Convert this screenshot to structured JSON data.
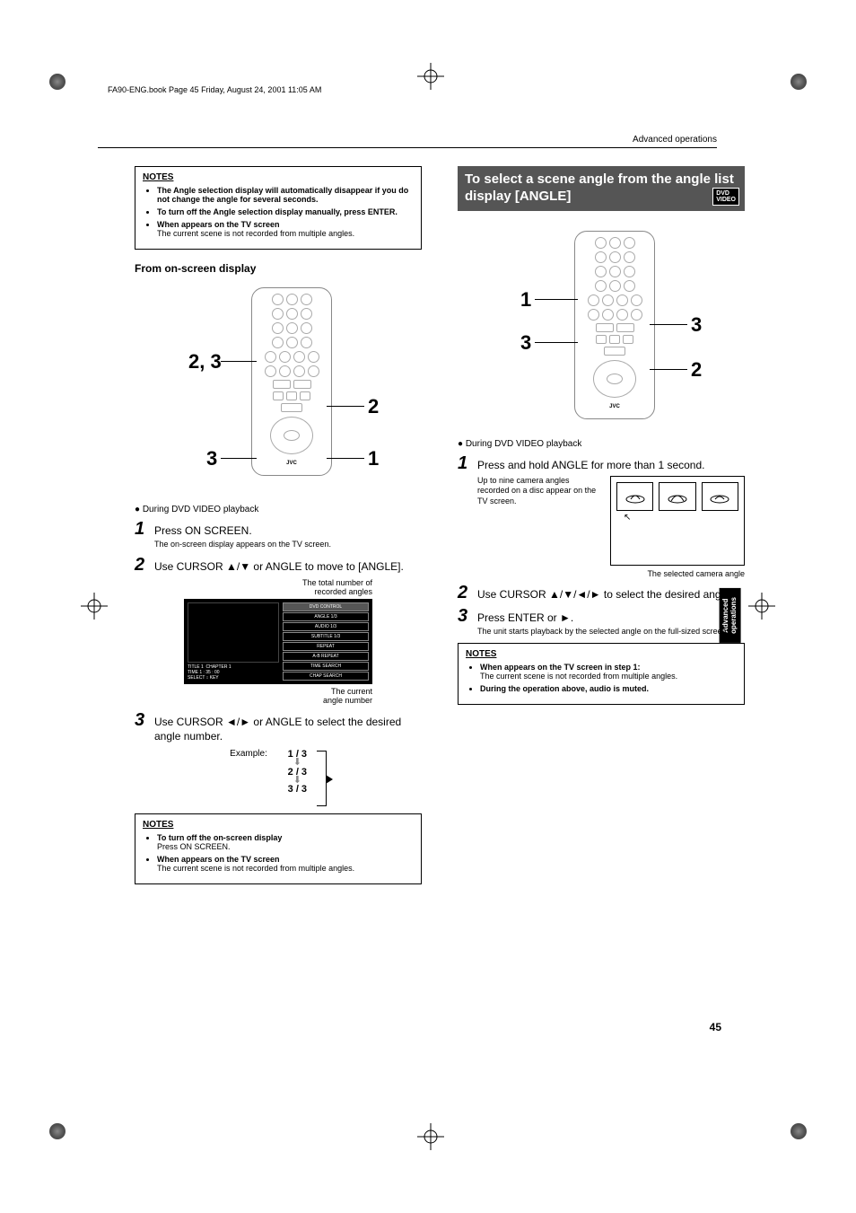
{
  "header_line": "FA90-ENG.book  Page 45  Friday, August 24, 2001  11:05 AM",
  "running_head": "Advanced operations",
  "side_tab": "Advanced\noperations",
  "page_number": "45",
  "left": {
    "notes1": {
      "title": "NOTES",
      "items": [
        {
          "bold": "The Angle selection display will automatically disappear if you do not change the angle for several seconds.",
          "body": ""
        },
        {
          "bold": "To turn off the Angle selection display manually, press ENTER.",
          "body": ""
        },
        {
          "bold": "When     appears on the TV screen",
          "body": "The current scene is not recorded from multiple angles."
        }
      ]
    },
    "subhead": "From on-screen display",
    "remote_callouts": {
      "left_top": "2, 3",
      "left_bottom": "3",
      "right_mid": "2",
      "right_bottom": "1"
    },
    "playback_line": "During DVD VIDEO playback",
    "steps": [
      {
        "num": "1",
        "text": "Press ON SCREEN.",
        "body": "The on-screen display appears on the TV screen."
      },
      {
        "num": "2",
        "text": "Use CURSOR ▲/▼ or ANGLE to move      to [ANGLE].",
        "body": ""
      }
    ],
    "osd": {
      "label_top": "The total number of\nrecorded angles",
      "title": "DVD CONTROL",
      "rows": [
        "ANGLE   1/3",
        "AUDIO   1/3",
        "SUBTITLE 1/3",
        "REPEAT",
        "A-B REPEAT",
        "TIME SEARCH",
        "CHAP SEARCH"
      ],
      "bottom_left": "TITLE 1  CHAPTER 1\nTIME 1 : 35 : 00\nSELECT ↕ KEY",
      "label_bottom": "The current\nangle number"
    },
    "step3": {
      "num": "3",
      "text": "Use CURSOR ◄/► or ANGLE to select the desired angle number."
    },
    "example": {
      "label": "Example:",
      "values": [
        "1 / 3",
        "2 / 3",
        "3 / 3"
      ]
    },
    "notes2": {
      "title": "NOTES",
      "items": [
        {
          "bold": "To turn off the on-screen display",
          "body": "Press ON SCREEN."
        },
        {
          "bold": "When     appears on the TV screen",
          "body": "The current scene is not recorded from multiple angles."
        }
      ]
    }
  },
  "right": {
    "section_title": "To select a scene angle from the angle list display [ANGLE]",
    "dvd_badge": "DVD\nVIDEO",
    "remote_callouts": {
      "left_top": "1",
      "left_bottom": "3",
      "right_top": "3",
      "right_bottom": "2"
    },
    "playback_line": "During DVD VIDEO playback",
    "step1": {
      "num": "1",
      "text": "Press and hold ANGLE for more than 1 second.",
      "body": "Up to nine camera angles recorded on a disc appear on the TV screen."
    },
    "tv_label": "The selected camera angle",
    "step2": {
      "num": "2",
      "text": "Use CURSOR ▲/▼/◄/► to select the desired angle."
    },
    "step3": {
      "num": "3",
      "text": "Press ENTER or ►.",
      "body": "The unit starts playback by the selected angle on the full-sized screen."
    },
    "notes": {
      "title": "NOTES",
      "items": [
        {
          "bold": "When     appears on the TV screen in step 1:",
          "body": "The current scene is not recorded from multiple angles."
        },
        {
          "bold": "During the operation above, audio is muted.",
          "body": ""
        }
      ]
    }
  }
}
